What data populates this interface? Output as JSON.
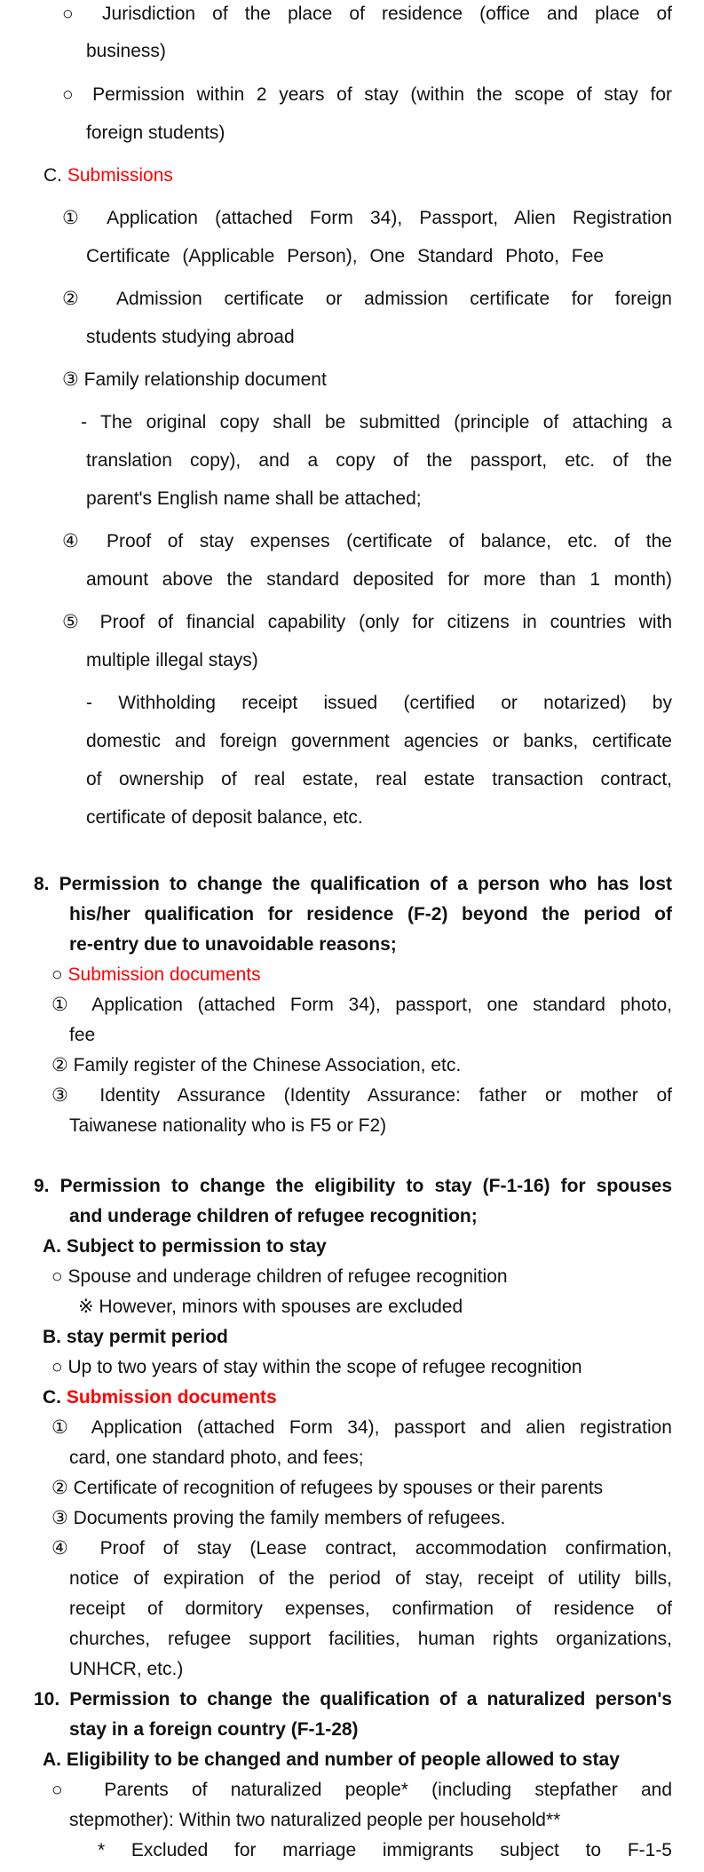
{
  "section7": {
    "b_lines": [
      "○ Jurisdiction of the place of residence (office and place of",
      "business)",
      "○ Permission within 2 years of stay (within the scope of stay for",
      "foreign students)"
    ],
    "c_prefix": "C. ",
    "c_title": "Submissions",
    "c_lines": [
      "① Application (attached Form 34), Passport, Alien Registration",
      "Certificate (Applicable Person), One Standard Photo, Fee",
      "② Admission certificate or admission certificate for foreign",
      "students studying abroad",
      "③ Family relationship document",
      "- The original copy shall be submitted (principle of attaching a",
      "translation copy), and a copy of the passport, etc. of the",
      "parent's English name shall be attached;",
      "④ Proof of stay expenses (certificate of balance, etc. of the",
      "amount above the standard deposited for more than 1 month)",
      "⑤ Proof of financial capability (only for citizens in countries with",
      "multiple illegal stays)",
      "- Withholding receipt issued (certified or notarized) by",
      "domestic and foreign government agencies or banks, certificate",
      "of ownership of real estate, real estate transaction contract,",
      "certificate of deposit balance, etc."
    ]
  },
  "section8": {
    "heading": [
      "8. Permission to change the qualification of a person who has lost",
      "his/her qualification for residence (F-2) beyond the period of",
      "re-entry due to unavoidable reasons;"
    ],
    "sub_prefix": "○ ",
    "sub_title": "Submission documents",
    "items": [
      "① Application (attached Form 34), passport, one standard photo,",
      "fee",
      "② Family register of the Chinese Association, etc.",
      "③ Identity Assurance (Identity Assurance: father or mother of",
      "Taiwanese nationality who is F5 or F2)"
    ]
  },
  "section9": {
    "heading": [
      "9. Permission to change the eligibility to stay (F-1-16) for spouses",
      "and underage children of refugee recognition;"
    ],
    "a_title": "A. Subject to permission to stay",
    "a_items": [
      "○ Spouse and underage children of refugee recognition",
      "※ However, minors with spouses are excluded"
    ],
    "b_title": "B. stay permit period",
    "b_items": [
      "○ Up to two years of stay within the scope of refugee recognition"
    ],
    "c_prefix": "C. ",
    "c_title": "Submission documents",
    "c_items": [
      "① Application (attached Form 34), passport and alien registration",
      "card, one standard photo, and fees;",
      "② Certificate of recognition of refugees by spouses or their parents",
      "③ Documents proving the family members of refugees.",
      "④ Proof of stay (Lease contract, accommodation confirmation,",
      "notice of expiration of the period of stay, receipt of utility bills,",
      "receipt of dormitory expenses, confirmation of residence of",
      "churches, refugee support facilities, human rights organizations,",
      "UNHCR, etc.)"
    ]
  },
  "section10": {
    "heading": [
      "10. Permission to change the qualification of a naturalized person's",
      "stay in a foreign country (F-1-28)"
    ],
    "a_title": "A. Eligibility to be changed and number of people allowed to stay",
    "a_items": [
      "○ Parents of naturalized people* (including stepfather and",
      "stepmother): Within two naturalized people per household**",
      "* Excluded for marriage immigrants subject to F-1-5"
    ]
  }
}
